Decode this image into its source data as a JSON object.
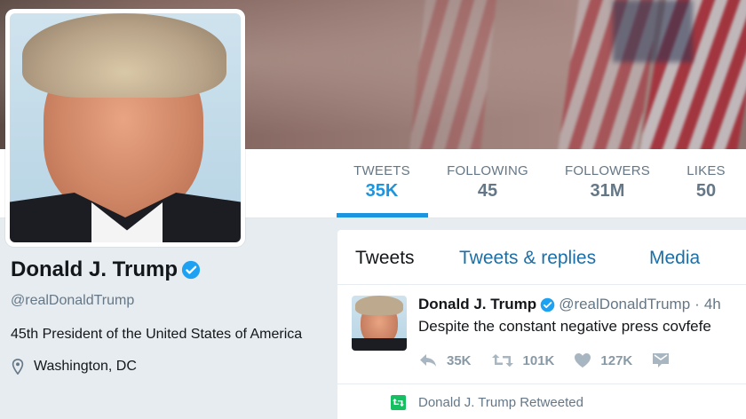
{
  "profile": {
    "name": "Donald J. Trump",
    "handle": "@realDonaldTrump",
    "bio": "45th President of the United States of America",
    "location": "Washington, DC"
  },
  "stats": [
    {
      "label": "TWEETS",
      "value": "35K",
      "active": true
    },
    {
      "label": "FOLLOWING",
      "value": "45"
    },
    {
      "label": "FOLLOWERS",
      "value": "31M"
    },
    {
      "label": "LIKES",
      "value": "50"
    }
  ],
  "timeline": {
    "tabs": [
      "Tweets",
      "Tweets & replies",
      "Media"
    ],
    "tweet": {
      "name": "Donald J. Trump",
      "handle": "@realDonaldTrump",
      "separator": "·",
      "time": "4h",
      "text": "Despite the constant negative press covfefe",
      "replies": "35K",
      "retweets": "101K",
      "likes": "127K"
    },
    "retweet_notice": "Donald J. Trump Retweeted"
  },
  "colors": {
    "accent": "#1b95e0",
    "verified": "#1da1f2",
    "retweet": "#17bf63",
    "muted": "#657786"
  },
  "icons": [
    "verified-badge-icon",
    "location-pin-icon",
    "reply-icon",
    "retweet-icon",
    "heart-icon",
    "direct-message-icon"
  ]
}
